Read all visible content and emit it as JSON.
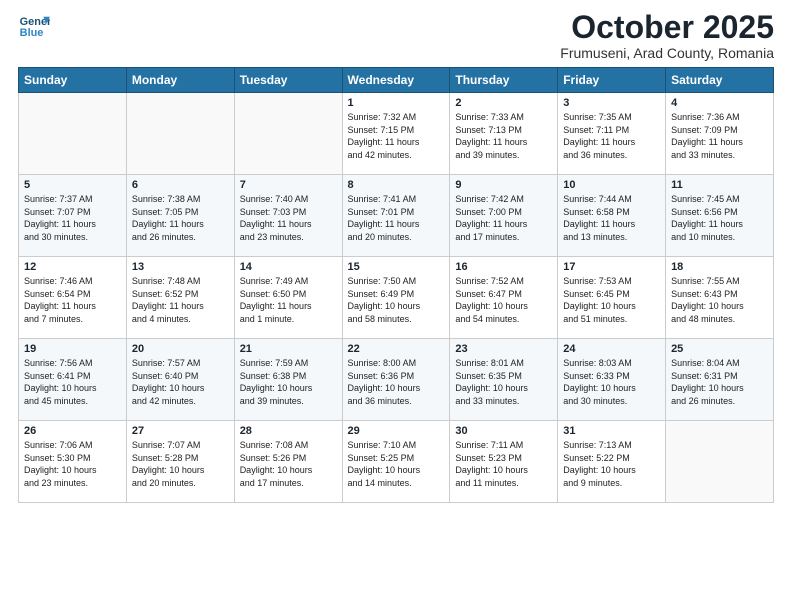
{
  "logo": {
    "line1": "General",
    "line2": "Blue"
  },
  "title": "October 2025",
  "location": "Frumuseni, Arad County, Romania",
  "days_header": [
    "Sunday",
    "Monday",
    "Tuesday",
    "Wednesday",
    "Thursday",
    "Friday",
    "Saturday"
  ],
  "weeks": [
    [
      {
        "num": "",
        "info": ""
      },
      {
        "num": "",
        "info": ""
      },
      {
        "num": "",
        "info": ""
      },
      {
        "num": "1",
        "info": "Sunrise: 7:32 AM\nSunset: 7:15 PM\nDaylight: 11 hours\nand 42 minutes."
      },
      {
        "num": "2",
        "info": "Sunrise: 7:33 AM\nSunset: 7:13 PM\nDaylight: 11 hours\nand 39 minutes."
      },
      {
        "num": "3",
        "info": "Sunrise: 7:35 AM\nSunset: 7:11 PM\nDaylight: 11 hours\nand 36 minutes."
      },
      {
        "num": "4",
        "info": "Sunrise: 7:36 AM\nSunset: 7:09 PM\nDaylight: 11 hours\nand 33 minutes."
      }
    ],
    [
      {
        "num": "5",
        "info": "Sunrise: 7:37 AM\nSunset: 7:07 PM\nDaylight: 11 hours\nand 30 minutes."
      },
      {
        "num": "6",
        "info": "Sunrise: 7:38 AM\nSunset: 7:05 PM\nDaylight: 11 hours\nand 26 minutes."
      },
      {
        "num": "7",
        "info": "Sunrise: 7:40 AM\nSunset: 7:03 PM\nDaylight: 11 hours\nand 23 minutes."
      },
      {
        "num": "8",
        "info": "Sunrise: 7:41 AM\nSunset: 7:01 PM\nDaylight: 11 hours\nand 20 minutes."
      },
      {
        "num": "9",
        "info": "Sunrise: 7:42 AM\nSunset: 7:00 PM\nDaylight: 11 hours\nand 17 minutes."
      },
      {
        "num": "10",
        "info": "Sunrise: 7:44 AM\nSunset: 6:58 PM\nDaylight: 11 hours\nand 13 minutes."
      },
      {
        "num": "11",
        "info": "Sunrise: 7:45 AM\nSunset: 6:56 PM\nDaylight: 11 hours\nand 10 minutes."
      }
    ],
    [
      {
        "num": "12",
        "info": "Sunrise: 7:46 AM\nSunset: 6:54 PM\nDaylight: 11 hours\nand 7 minutes."
      },
      {
        "num": "13",
        "info": "Sunrise: 7:48 AM\nSunset: 6:52 PM\nDaylight: 11 hours\nand 4 minutes."
      },
      {
        "num": "14",
        "info": "Sunrise: 7:49 AM\nSunset: 6:50 PM\nDaylight: 11 hours\nand 1 minute."
      },
      {
        "num": "15",
        "info": "Sunrise: 7:50 AM\nSunset: 6:49 PM\nDaylight: 10 hours\nand 58 minutes."
      },
      {
        "num": "16",
        "info": "Sunrise: 7:52 AM\nSunset: 6:47 PM\nDaylight: 10 hours\nand 54 minutes."
      },
      {
        "num": "17",
        "info": "Sunrise: 7:53 AM\nSunset: 6:45 PM\nDaylight: 10 hours\nand 51 minutes."
      },
      {
        "num": "18",
        "info": "Sunrise: 7:55 AM\nSunset: 6:43 PM\nDaylight: 10 hours\nand 48 minutes."
      }
    ],
    [
      {
        "num": "19",
        "info": "Sunrise: 7:56 AM\nSunset: 6:41 PM\nDaylight: 10 hours\nand 45 minutes."
      },
      {
        "num": "20",
        "info": "Sunrise: 7:57 AM\nSunset: 6:40 PM\nDaylight: 10 hours\nand 42 minutes."
      },
      {
        "num": "21",
        "info": "Sunrise: 7:59 AM\nSunset: 6:38 PM\nDaylight: 10 hours\nand 39 minutes."
      },
      {
        "num": "22",
        "info": "Sunrise: 8:00 AM\nSunset: 6:36 PM\nDaylight: 10 hours\nand 36 minutes."
      },
      {
        "num": "23",
        "info": "Sunrise: 8:01 AM\nSunset: 6:35 PM\nDaylight: 10 hours\nand 33 minutes."
      },
      {
        "num": "24",
        "info": "Sunrise: 8:03 AM\nSunset: 6:33 PM\nDaylight: 10 hours\nand 30 minutes."
      },
      {
        "num": "25",
        "info": "Sunrise: 8:04 AM\nSunset: 6:31 PM\nDaylight: 10 hours\nand 26 minutes."
      }
    ],
    [
      {
        "num": "26",
        "info": "Sunrise: 7:06 AM\nSunset: 5:30 PM\nDaylight: 10 hours\nand 23 minutes."
      },
      {
        "num": "27",
        "info": "Sunrise: 7:07 AM\nSunset: 5:28 PM\nDaylight: 10 hours\nand 20 minutes."
      },
      {
        "num": "28",
        "info": "Sunrise: 7:08 AM\nSunset: 5:26 PM\nDaylight: 10 hours\nand 17 minutes."
      },
      {
        "num": "29",
        "info": "Sunrise: 7:10 AM\nSunset: 5:25 PM\nDaylight: 10 hours\nand 14 minutes."
      },
      {
        "num": "30",
        "info": "Sunrise: 7:11 AM\nSunset: 5:23 PM\nDaylight: 10 hours\nand 11 minutes."
      },
      {
        "num": "31",
        "info": "Sunrise: 7:13 AM\nSunset: 5:22 PM\nDaylight: 10 hours\nand 9 minutes."
      },
      {
        "num": "",
        "info": ""
      }
    ]
  ]
}
